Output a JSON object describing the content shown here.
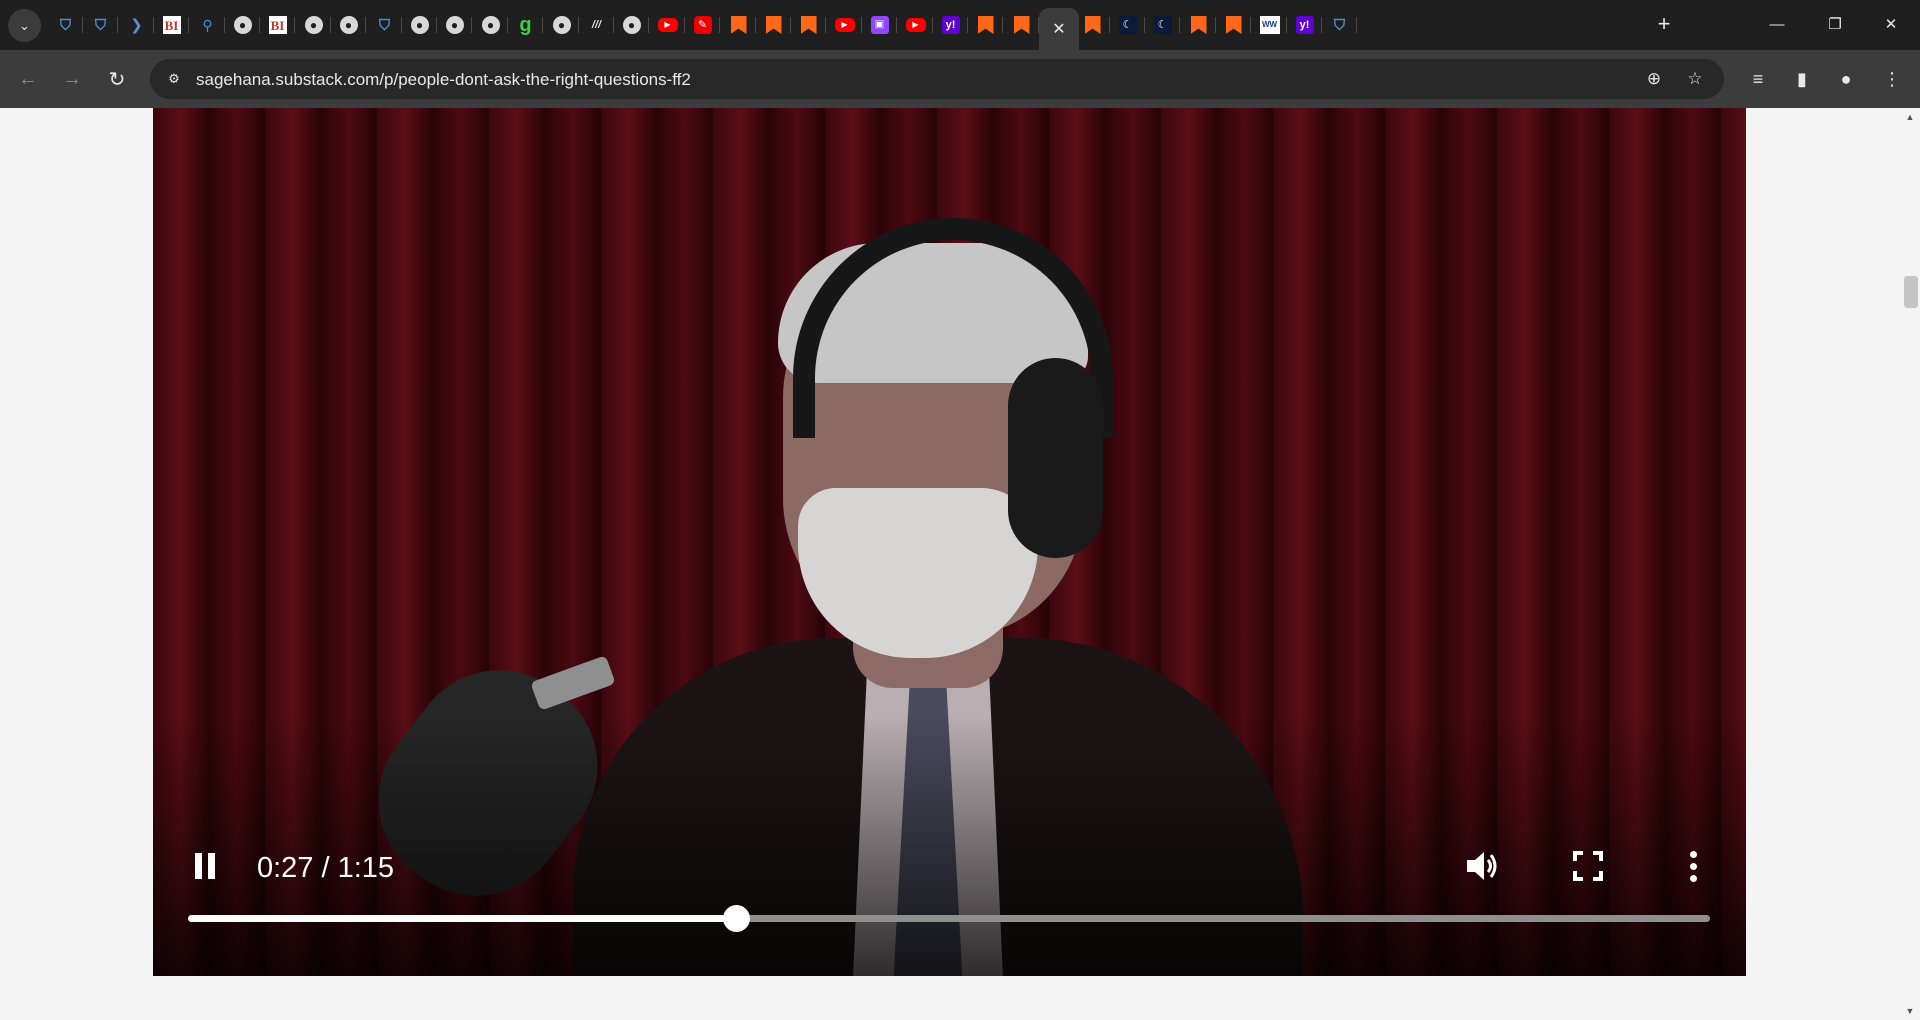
{
  "browser": {
    "address_bar": {
      "url": "sagehana.substack.com/p/people-dont-ask-the-right-questions-ff2"
    },
    "tabs": [
      {
        "favicon": "shield-icon",
        "glyph": "⛉"
      },
      {
        "favicon": "shield-icon",
        "glyph": "⛉"
      },
      {
        "favicon": "arrow-icon",
        "glyph": "❯"
      },
      {
        "favicon": "bi-icon",
        "glyph": "BI"
      },
      {
        "favicon": "search-icon",
        "glyph": "⚲"
      },
      {
        "favicon": "globe-icon",
        "glyph": "●"
      },
      {
        "favicon": "bi-icon",
        "glyph": "BI"
      },
      {
        "favicon": "globe-icon",
        "glyph": "●"
      },
      {
        "favicon": "globe-icon",
        "glyph": "●"
      },
      {
        "favicon": "shield-icon",
        "glyph": "⛉"
      },
      {
        "favicon": "globe-icon",
        "glyph": "●"
      },
      {
        "favicon": "globe-icon",
        "glyph": "●"
      },
      {
        "favicon": "globe-icon",
        "glyph": "●"
      },
      {
        "favicon": "g-icon",
        "glyph": "g"
      },
      {
        "favicon": "globe-icon",
        "glyph": "●"
      },
      {
        "favicon": "doc-icon",
        "glyph": "///"
      },
      {
        "favicon": "globe-icon",
        "glyph": "●"
      },
      {
        "favicon": "youtube-icon",
        "glyph": "▶"
      },
      {
        "favicon": "red-app-icon",
        "glyph": "✎"
      },
      {
        "favicon": "substack-icon",
        "glyph": ""
      },
      {
        "favicon": "substack-icon",
        "glyph": ""
      },
      {
        "favicon": "substack-icon",
        "glyph": ""
      },
      {
        "favicon": "youtube-icon",
        "glyph": "▶"
      },
      {
        "favicon": "twitch-icon",
        "glyph": "▣"
      },
      {
        "favicon": "youtube-icon",
        "glyph": "▶"
      },
      {
        "favicon": "yahoo-icon",
        "glyph": "y!"
      },
      {
        "favicon": "substack-icon",
        "glyph": ""
      },
      {
        "favicon": "substack-icon",
        "glyph": ""
      },
      {
        "favicon": "close-icon",
        "glyph": "✕",
        "active": true
      },
      {
        "favicon": "substack-icon",
        "glyph": ""
      },
      {
        "favicon": "dark-app-icon",
        "glyph": "☾"
      },
      {
        "favicon": "dark-app-icon",
        "glyph": "☾"
      },
      {
        "favicon": "substack-icon",
        "glyph": ""
      },
      {
        "favicon": "substack-icon",
        "glyph": ""
      },
      {
        "favicon": "ww-icon",
        "glyph": "WW"
      },
      {
        "favicon": "yahoo-icon",
        "glyph": "y!"
      },
      {
        "favicon": "shield-icon",
        "glyph": "⛉"
      }
    ]
  },
  "video_player": {
    "time_display": "0:27 / 1:15",
    "current_seconds": 27,
    "duration_seconds": 75,
    "playing": true
  },
  "colors": {
    "tabstrip": "#1f1f1f",
    "toolbar": "#3c3c3c",
    "omnibox": "#282828",
    "page_background": "#f4f4f4",
    "seek_played": "#ffffff",
    "seek_remaining": "#8f8f8f"
  }
}
